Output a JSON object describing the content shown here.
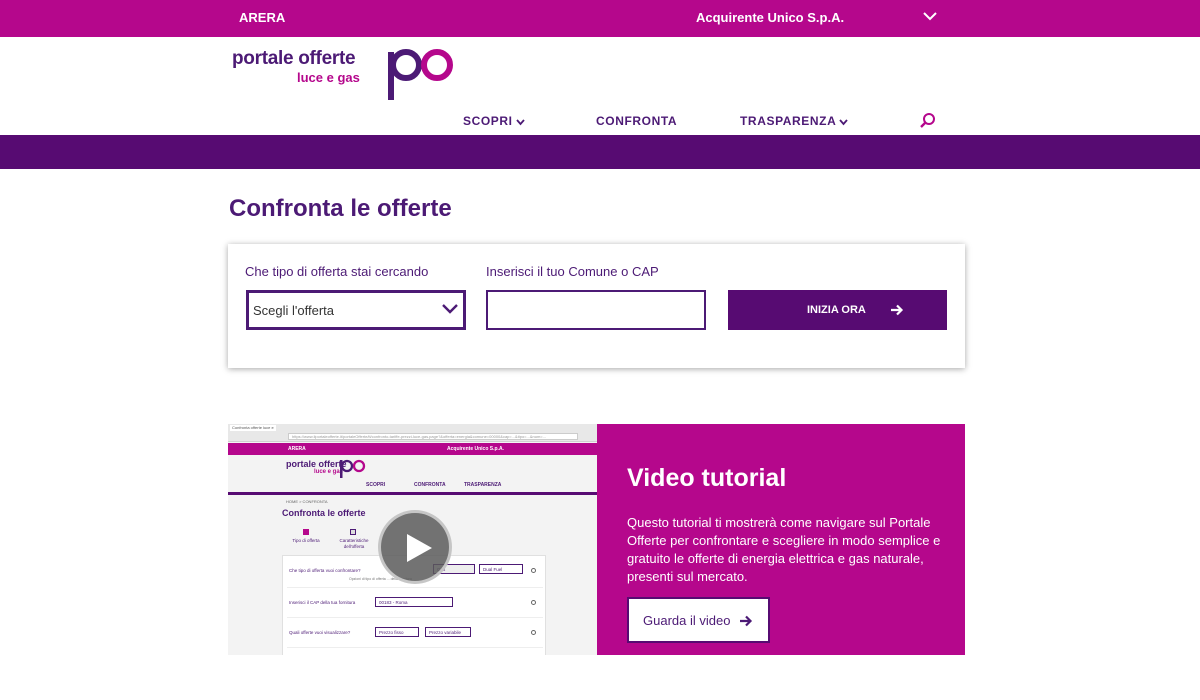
{
  "topbar": {
    "left_link": "ARERA",
    "right_link": "Acquirente Unico S.p.A."
  },
  "logo": {
    "line1": "portale offerte",
    "line2": "luce e gas"
  },
  "nav": {
    "items": [
      "SCOPRI",
      "CONFRONTA",
      "TRASPARENZA"
    ]
  },
  "page": {
    "title": "Confronta le offerte"
  },
  "search_form": {
    "offer_label": "Che tipo di offerta stai cercando",
    "offer_select_value": "Scegli l'offerta",
    "comune_label": "Inserisci il tuo Comune o CAP",
    "comune_value": "",
    "submit_label": "INIZIA ORA"
  },
  "video": {
    "title": "Video tutorial",
    "description": "Questo tutorial ti mostrerà come navigare sul Portale Offerte per confrontare e scegliere in modo semplice e gratuito le offerte di energia elettrica e gas naturale, presenti sul mercato.",
    "button_label": "Guarda il video"
  },
  "thumbnail": {
    "tab_title": "Confronta offerte luce e gas",
    "url": "https://www.ilportaleofferte.it/portaleOfferte/it/confronto-tariffe-prezzi-luce-gas.page?&offerta=energia&comune=00000&cap=...&tipo=...&num=...",
    "top_left": "ARERA",
    "top_right": "Acquirente Unico S.p.A.",
    "logo1": "portale offerte",
    "logo2": "luce e gas",
    "nav": [
      "SCOPRI",
      "CONFRONTA",
      "TRASPARENZA"
    ],
    "breadcrumb": "HOME > CONFRONTA",
    "title": "Confronta le offerte",
    "step1": "Tipo di offerta",
    "step2": "Caratteristiche dell'offerta",
    "q1": "Che tipo di offerta vuoi confrontare?",
    "q1_opt": "Gas",
    "q1_opt2": "Dual Fuel",
    "q1_note": "Opzioni di tipo di offerta ... della fornitura",
    "q2": "Inserisci il CAP della tua fornitura",
    "q2_value": "00183 - Roma",
    "q3": "Quali offerte vuoi visualizzare?",
    "q3_opt1": "Prezzo fisso",
    "q3_opt2": "Prezzo variabile"
  },
  "colors": {
    "magenta": "#b5078c",
    "purple": "#570b72",
    "text_purple": "#4c1a75"
  },
  "icons": [
    "chevron-down-icon",
    "search-icon",
    "arrow-right-icon",
    "play-icon"
  ]
}
